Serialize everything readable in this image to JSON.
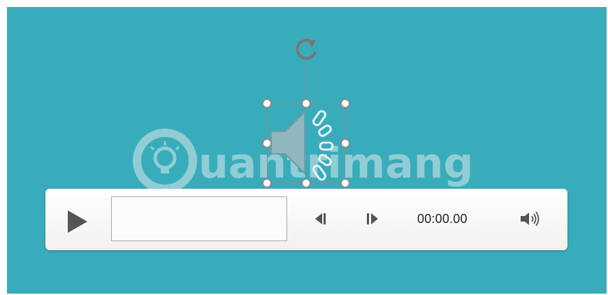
{
  "watermark": {
    "text": "uantrimang"
  },
  "audio_object": {
    "icon": "speaker-icon",
    "rotate_icon": "rotate-icon"
  },
  "player": {
    "play_icon": "play-icon",
    "back_icon": "skip-back-icon",
    "forward_icon": "skip-forward-icon",
    "time": "00:00.00",
    "volume_icon": "volume-icon"
  },
  "colors": {
    "slide_background": "#39acbb",
    "bar_background": "#f1f1f1",
    "icon_gray": "#555555"
  }
}
